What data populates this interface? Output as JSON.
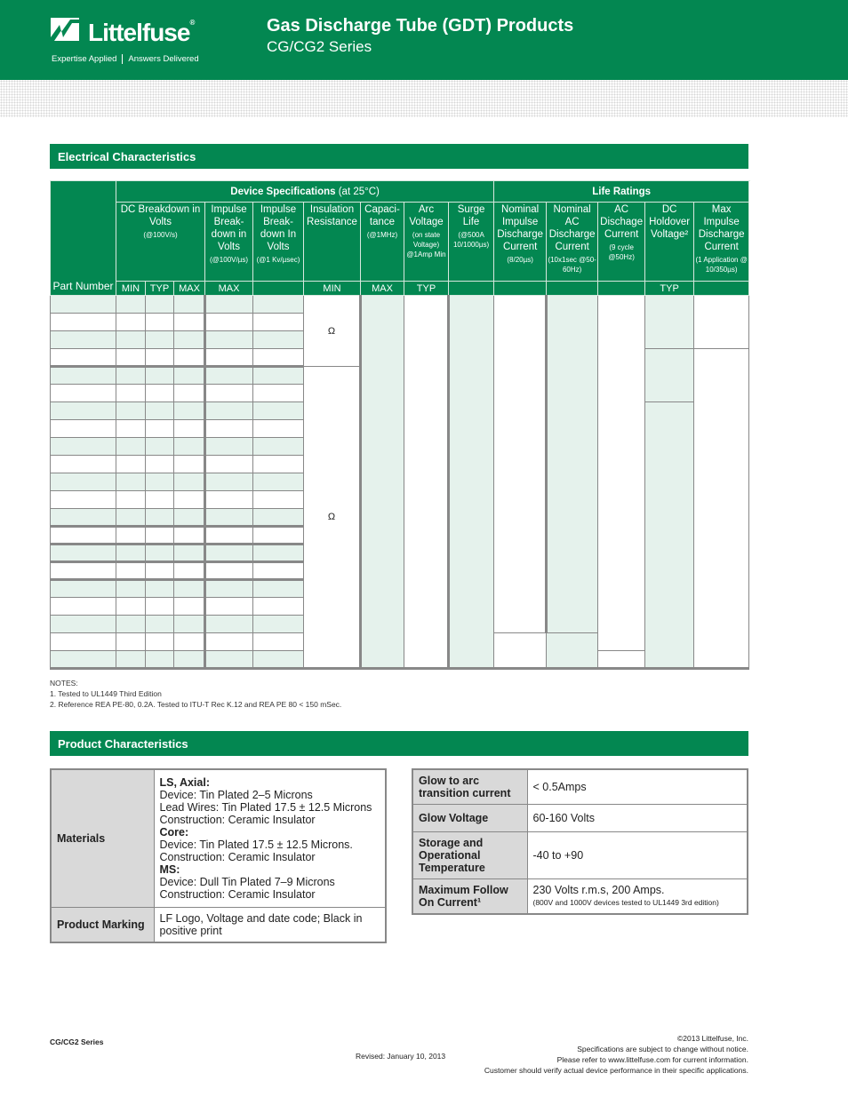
{
  "header": {
    "brand": "Littelfuse",
    "tagline_left": "Expertise Applied",
    "tagline_right": "Answers Delivered",
    "title": "Gas Discharge Tube (GDT) Products",
    "subtitle": "CG/CG2 Series",
    "brand_color": "#038751"
  },
  "electrical": {
    "section_title": "Electrical Characteristics",
    "part_number_header": "Part Number",
    "group_device": "Device Specifications",
    "group_device_cond": "(at 25°C)",
    "group_life": "Life Ratings",
    "columns": {
      "dc_breakdown": {
        "title": "DC Breakdown in Volts",
        "cond": "(@100V/s)"
      },
      "impulse1": {
        "title": "Impulse Break-down in Volts",
        "cond": "(@100V/µs)"
      },
      "impulse2": {
        "title": "Impulse Break-down In Volts",
        "cond": "(@1 Kv/µsec)"
      },
      "insulation": {
        "title": "Insulation Resistance",
        "cond": ""
      },
      "capacitance": {
        "title": "Capaci-tance",
        "cond": "(@1MHz)"
      },
      "arc_voltage": {
        "title": "Arc Voltage",
        "cond": "(on state Voltage) @1Amp Min"
      },
      "surge_life": {
        "title": "Surge Life",
        "cond": "(@500A 10/1000µs)"
      },
      "nominal_impulse": {
        "title": "Nominal Impulse Discharge Current",
        "cond": "(8/20µs)"
      },
      "nominal_ac": {
        "title": "Nominal AC Discharge Current",
        "cond": "(10x1sec @50-60Hz)"
      },
      "ac_discharge": {
        "title": "AC Dischage Current",
        "cond": "(9 cycle @50Hz)"
      },
      "dc_holdover": {
        "title": "DC Holdover Voltage²",
        "cond": ""
      },
      "max_impulse": {
        "title": "Max Impulse Discharge Current",
        "cond": "(1 Application @ 10/350µs)"
      }
    },
    "subheaders": {
      "min": "MIN",
      "typ": "TYP",
      "max": "MAX",
      "imp1": "MAX",
      "imp2": "",
      "ins": "MIN",
      "cap": "MAX",
      "arc": "TYP",
      "surge": "",
      "nomimp": "",
      "nomac": "",
      "acd": "",
      "dch": "TYP",
      "maximp": ""
    },
    "insulation_unit_1": "Ω",
    "insulation_unit_2": "Ω"
  },
  "notes": {
    "heading": "NOTES:",
    "items": [
      "1. Tested to UL1449 Third Edition",
      "2. Reference REA PE-80, 0.2A. Tested to ITU-T Rec K.12 and REA PE 80 < 150 mSec."
    ]
  },
  "product": {
    "section_title": "Product Characteristics",
    "materials_label": "Materials",
    "materials": [
      {
        "heading": "LS, Axial:",
        "lines": [
          "Device: Tin Plated 2–5 Microns",
          "Lead Wires: Tin Plated 17.5 ± 12.5 Microns",
          "Construction: Ceramic Insulator"
        ]
      },
      {
        "heading": "Core:",
        "lines": [
          "Device: Tin Plated 17.5 ± 12.5 Microns.",
          "Construction: Ceramic Insulator"
        ]
      },
      {
        "heading": "MS:",
        "lines": [
          "Device: Dull Tin Plated 7–9 Microns",
          "Construction: Ceramic Insulator"
        ]
      }
    ],
    "marking_label": "Product Marking",
    "marking_value": "LF Logo, Voltage and date code; Black in positive print",
    "right": [
      {
        "label": "Glow to arc transition current",
        "value": "< 0.5Amps",
        "note": ""
      },
      {
        "label": "Glow Voltage",
        "value": "60-160 Volts",
        "note": ""
      },
      {
        "label": "Storage and Operational Temperature",
        "value": "-40 to +90",
        "note": ""
      },
      {
        "label": "Maximum Follow On Current¹",
        "value": "230 Volts r.m.s, 200 Amps.",
        "note": "(800V and 1000V devices tested to UL1449 3rd edition)"
      }
    ]
  },
  "footer": {
    "series": "CG/CG2 Series",
    "revised": "Revised: January 10, 2013",
    "copyright": "©2013 Littelfuse, Inc.",
    "line2": "Specifications are subject to change without notice.",
    "line3": "Please refer to www.littelfuse.com for current information.",
    "line4": "Customer should verify actual device performance in their specific applications."
  }
}
